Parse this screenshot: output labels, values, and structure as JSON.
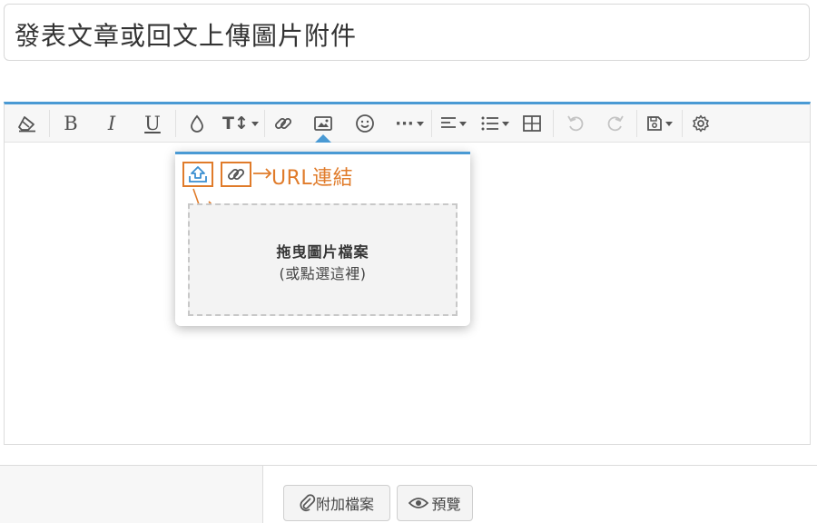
{
  "title": {
    "value": "發表文章或回文上傳圖片附件"
  },
  "toolbar": {
    "buttons": [
      {
        "name": "clear-format-icon",
        "glyph": "eraser"
      },
      {
        "name": "bold-icon",
        "glyph": "B"
      },
      {
        "name": "italic-icon",
        "glyph": "I"
      },
      {
        "name": "underline-icon",
        "glyph": "U"
      },
      {
        "name": "text-color-icon",
        "glyph": "drop"
      },
      {
        "name": "font-size-icon",
        "glyph": "T↕"
      },
      {
        "name": "insert-link-icon",
        "glyph": "link"
      },
      {
        "name": "insert-image-icon",
        "glyph": "image"
      },
      {
        "name": "insert-emoji-icon",
        "glyph": "smile"
      },
      {
        "name": "more-options-icon",
        "glyph": "…"
      },
      {
        "name": "align-icon",
        "glyph": "align"
      },
      {
        "name": "list-icon",
        "glyph": "list"
      },
      {
        "name": "insert-table-icon",
        "glyph": "table"
      },
      {
        "name": "undo-icon",
        "glyph": "undo"
      },
      {
        "name": "redo-icon",
        "glyph": "redo"
      },
      {
        "name": "save-draft-icon",
        "glyph": "save"
      },
      {
        "name": "settings-icon",
        "glyph": "gear"
      }
    ]
  },
  "image_popup": {
    "annotation_label": "URL連結",
    "dropzone_title": "拖曳圖片檔案",
    "dropzone_subtitle": "(或點選這裡)",
    "accent_color": "#4a9ad4",
    "annotation_color": "#e07b2a"
  },
  "footer": {
    "attach_label": "附加檔案",
    "preview_label": "預覽"
  }
}
